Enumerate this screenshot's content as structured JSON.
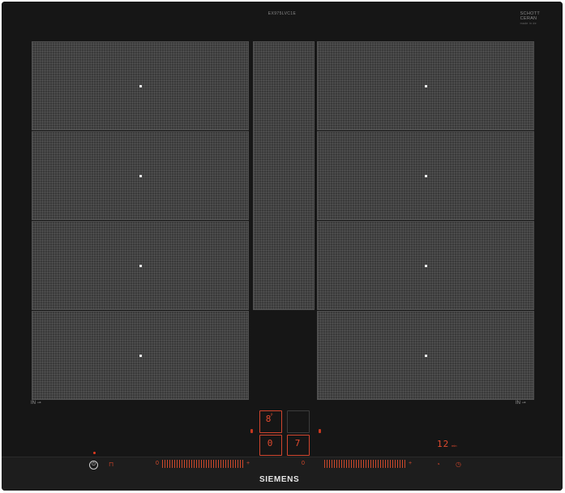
{
  "top_label": "EX975LVC1E",
  "glass_brand": {
    "line1": "SCHOTT",
    "line2": "CERAN",
    "line3": "®",
    "small": "made in de"
  },
  "zones": {
    "left": [
      "",
      "",
      "",
      ""
    ],
    "right": [
      "",
      "",
      "",
      ""
    ],
    "middle": ""
  },
  "induction_labels": {
    "left": "IN",
    "right": "IN"
  },
  "displays": {
    "zone_power": "8",
    "zone_power_sub": "P",
    "small_left": "0",
    "small_right": "7",
    "timer_value": "12",
    "timer_unit": "min"
  },
  "controls": {
    "power_symbol": "⏻",
    "left_slider_start": "0",
    "left_slider_end": "+",
    "right_slider_start": "0",
    "right_slider_end": "+",
    "lock_icon": "⊓",
    "timer_icon": "◔",
    "clock_icon": "◷"
  },
  "colors": {
    "glass": "#121212",
    "zone_fill": "#3a3a3a",
    "accent_red": "#e24a2e",
    "brand_text": "#e6e6e6"
  },
  "brand": "SIEMENS"
}
